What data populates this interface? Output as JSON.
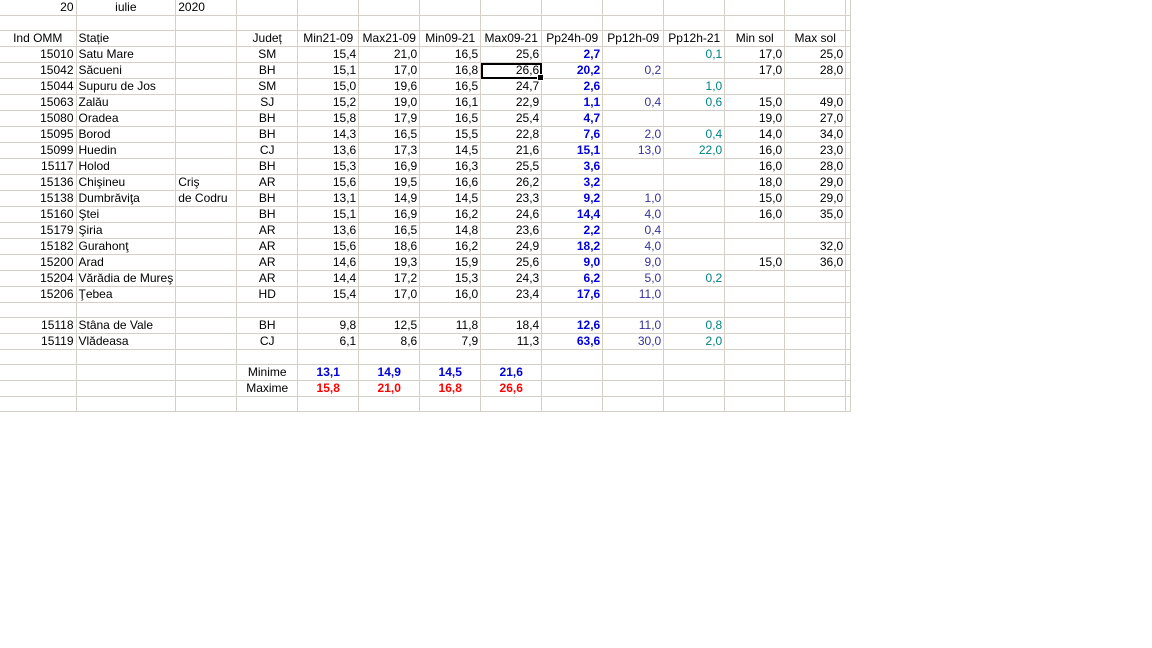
{
  "date": {
    "day": "20",
    "month": "iulie",
    "year": "2020"
  },
  "headers": [
    "Ind OMM",
    "Stație",
    "",
    "Județ",
    "Min21-09",
    "Max21-09",
    "Min09-21",
    "Max09-21",
    "Pp24h-09",
    "Pp12h-09",
    "Pp12h-21",
    "Min sol",
    "Max sol"
  ],
  "rows": [
    [
      "15010",
      "Satu Mare",
      "",
      "SM",
      "15,4",
      "21,0",
      "16,5",
      "25,6",
      "2,7",
      "",
      "0,1",
      "17,0",
      "25,0"
    ],
    [
      "15042",
      "Săcueni",
      "",
      "BH",
      "15,1",
      "17,0",
      "16,8",
      "26,6",
      "20,2",
      "0,2",
      "",
      "17,0",
      "28,0"
    ],
    [
      "15044",
      "Supuru de Jos",
      "",
      "SM",
      "15,0",
      "19,6",
      "16,5",
      "24,7",
      "2,6",
      "",
      "1,0",
      "",
      ""
    ],
    [
      "15063",
      "Zalău",
      "",
      "SJ",
      "15,2",
      "19,0",
      "16,1",
      "22,9",
      "1,1",
      "0,4",
      "0,6",
      "15,0",
      "49,0"
    ],
    [
      "15080",
      "Oradea",
      "",
      "BH",
      "15,8",
      "17,9",
      "16,5",
      "25,4",
      "4,7",
      "",
      "",
      "19,0",
      "27,0"
    ],
    [
      "15095",
      "Borod",
      "",
      "BH",
      "14,3",
      "16,5",
      "15,5",
      "22,8",
      "7,6",
      "2,0",
      "0,4",
      "14,0",
      "34,0"
    ],
    [
      "15099",
      "Huedin",
      "",
      "CJ",
      "13,6",
      "17,3",
      "14,5",
      "21,6",
      "15,1",
      "13,0",
      "22,0",
      "16,0",
      "23,0"
    ],
    [
      "15117",
      "Holod",
      "",
      "BH",
      "15,3",
      "16,9",
      "16,3",
      "25,5",
      "3,6",
      "",
      "",
      "16,0",
      "28,0"
    ],
    [
      "15136",
      "Chişineu",
      "Criş",
      "AR",
      "15,6",
      "19,5",
      "16,6",
      "26,2",
      "3,2",
      "",
      "",
      "18,0",
      "29,0"
    ],
    [
      "15138",
      "Dumbrăviţa",
      "de Codru",
      "BH",
      "13,1",
      "14,9",
      "14,5",
      "23,3",
      "9,2",
      "1,0",
      "",
      "15,0",
      "29,0"
    ],
    [
      "15160",
      "Ştei",
      "",
      "BH",
      "15,1",
      "16,9",
      "16,2",
      "24,6",
      "14,4",
      "4,0",
      "",
      "16,0",
      "35,0"
    ],
    [
      "15179",
      "Şiria",
      "",
      "AR",
      "13,6",
      "16,5",
      "14,8",
      "23,6",
      "2,2",
      "0,4",
      "",
      "",
      ""
    ],
    [
      "15182",
      "Gurahonţ",
      "",
      "AR",
      "15,6",
      "18,6",
      "16,2",
      "24,9",
      "18,2",
      "4,0",
      "",
      "",
      "32,0"
    ],
    [
      "15200",
      "Arad",
      "",
      "AR",
      "14,6",
      "19,3",
      "15,9",
      "25,6",
      "9,0",
      "9,0",
      "",
      "15,0",
      "36,0"
    ],
    [
      "15204",
      "Vărădia de Mureş",
      "",
      "AR",
      "14,4",
      "17,2",
      "15,3",
      "24,3",
      "6,2",
      "5,0",
      "0,2",
      "",
      ""
    ],
    [
      "15206",
      "Ţebea",
      "",
      "HD",
      "15,4",
      "17,0",
      "16,0",
      "23,4",
      "17,6",
      "11,0",
      "",
      "",
      ""
    ],
    [
      "",
      "",
      "",
      "",
      "",
      "",
      "",
      "",
      "",
      "",
      "",
      "",
      ""
    ],
    [
      "15118",
      "Stâna de Vale",
      "",
      "BH",
      "9,8",
      "12,5",
      "11,8",
      "18,4",
      "12,6",
      "11,0",
      "0,8",
      "",
      ""
    ],
    [
      "15119",
      "Vlădeasa",
      "",
      "CJ",
      "6,1",
      "8,6",
      "7,9",
      "11,3",
      "63,6",
      "30,0",
      "2,0",
      "",
      ""
    ]
  ],
  "summary": [
    {
      "label": "Minime",
      "values": [
        "13,1",
        "14,9",
        "14,5",
        "21,6"
      ]
    },
    {
      "label": "Maxime",
      "values": [
        "15,8",
        "21,0",
        "16,8",
        "26,6"
      ]
    }
  ],
  "colors": {
    "grid": "#d4d0c8",
    "bold_blue": "#0000dd",
    "bold_red": "#ff0000",
    "precip12": "#333399",
    "precip12b": "#008080"
  }
}
